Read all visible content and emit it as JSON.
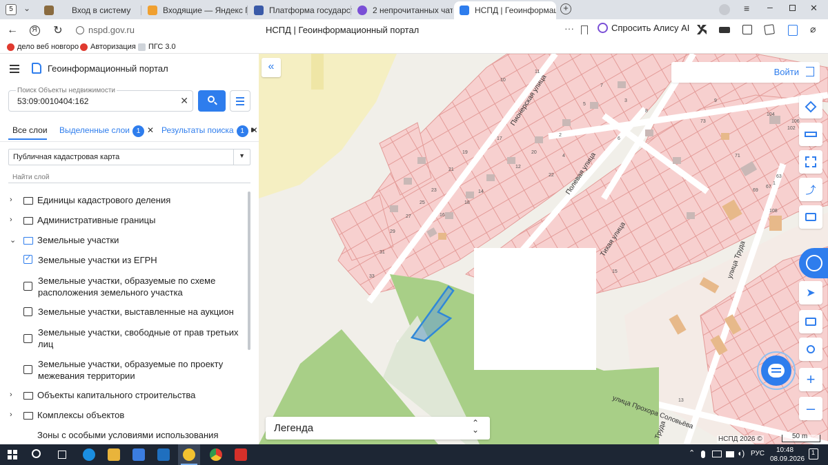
{
  "browser": {
    "tab_counter": "5",
    "tabs": [
      {
        "title": "Вход в систему",
        "color": "#8a6b3f"
      },
      {
        "title": "Входящие — Яндекс Почт",
        "color": "#f0a030"
      },
      {
        "title": "Платформа государстве",
        "color": "#3a5aa8"
      },
      {
        "title": "2 непрочитанных чата",
        "color": "#7a4fd6"
      },
      {
        "title": "НСПД | Геоинформаци",
        "color": "#2e7ded"
      }
    ],
    "url": "nspd.gov.ru",
    "page_title": "НСПД | Геоинформационный портал",
    "alice_label": "Спросить Алису AI",
    "bookmarks": [
      "дело веб новгоро",
      "Авторизация",
      "ПГС 3.0"
    ]
  },
  "panel": {
    "app_title": "Геоинформационный портал",
    "search_label": "Поиск Объекты недвижимости",
    "search_value": "53:09:0010404:162",
    "tabs": [
      {
        "label": "Все слои"
      },
      {
        "label": "Выделенные слои",
        "badge": "1"
      },
      {
        "label": "Результаты поиска",
        "badge": "1"
      }
    ],
    "basemap": "Публичная кадастровая карта",
    "layer_search_placeholder": "Найти слой",
    "tree": [
      {
        "label": "Единицы кадастрового деления"
      },
      {
        "label": "Административные границы"
      },
      {
        "label": "Земельные участки"
      },
      {
        "label": "Объекты капитального строительства"
      },
      {
        "label": "Комплексы объектов"
      },
      {
        "label": "Зоны с особыми условиями использования"
      }
    ],
    "sublayers": [
      {
        "label": "Земельные участки из ЕГРН",
        "checked": true
      },
      {
        "label": "Земельные участки, образуемые по схеме расположения земельного участка",
        "checked": false
      },
      {
        "label": "Земельные участки, выставленные на аукцион",
        "checked": false
      },
      {
        "label": "Земельные участки, свободные от прав третьих лиц",
        "checked": false
      },
      {
        "label": "Земельные участки, образуемые по проекту межевания территории",
        "checked": false
      }
    ]
  },
  "map": {
    "login_label": "Войти",
    "legend_label": "Легенда",
    "copyright": "НСПД 2026 ©",
    "scale": "50 m",
    "streets": [
      "Пионерская улица",
      "Полевая улица",
      "Тихая улица",
      "улица Труда",
      "улица Прохора Соловьёва",
      "Труда"
    ],
    "parcel_numbers": [
      "11",
      "10",
      "7",
      "5",
      "3",
      "8",
      "6",
      "4",
      "2",
      "17",
      "19",
      "21",
      "23",
      "25",
      "27",
      "29",
      "31",
      "33",
      "16",
      "18",
      "14",
      "12",
      "20",
      "22",
      "9",
      "73",
      "71",
      "69",
      "67",
      "63",
      "1",
      "108",
      "106",
      "104",
      "102",
      "13",
      "15"
    ],
    "colors": {
      "parcel": "#f7d0cf",
      "parcel_border": "#e39b98",
      "green": "#a8cf87",
      "yellow_zone": "#f5efc2",
      "selected": "#2f88d8"
    }
  },
  "taskbar": {
    "time": "10:48",
    "date": "08.09.2026",
    "lang": "РУС",
    "notifications": "1"
  }
}
